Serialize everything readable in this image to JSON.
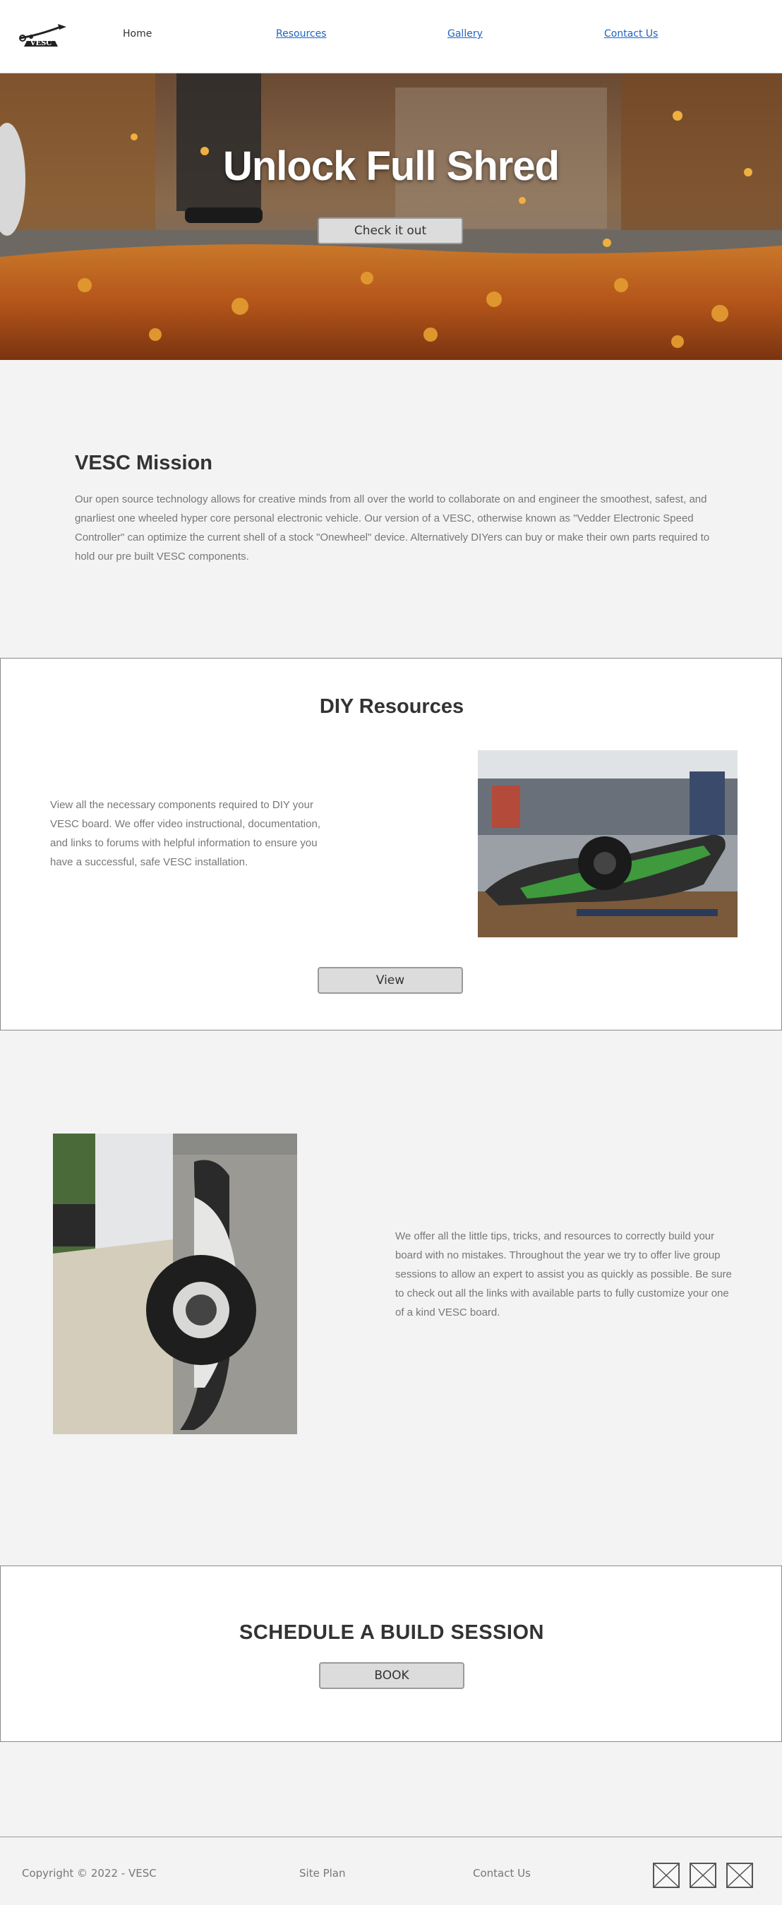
{
  "header": {
    "logo_text": "VESC",
    "nav": {
      "home": "Home",
      "resources": "Resources",
      "gallery": "Gallery",
      "contact": "Contact Us"
    }
  },
  "hero": {
    "title": "Unlock Full Shred",
    "button": "Check it out"
  },
  "mission": {
    "title": "VESC Mission",
    "text": "Our open source technology allows for creative minds from all over the world to collaborate on and engineer the smoothest, safest, and gnarliest one wheeled hyper core personal electronic vehicle. Our version of a VESC, otherwise known as \"Vedder Electronic Speed Controller\" can optimize the current shell of a stock \"Onewheel\" device. Alternatively DIYers can buy or make their own parts required to hold our pre built VESC components."
  },
  "diy": {
    "title": "DIY Resources",
    "text": "View all the necessary components required to DIY your VESC board.  We offer video instructional, documentation, and links to forums with helpful information to ensure you have a successful, safe VESC installation.",
    "button": "View"
  },
  "tips": {
    "text": "We offer all the little tips, tricks, and resources to correctly build your board with no mistakes. Throughout the year we try to offer live group sessions to allow an expert to assist you as quickly as possible. Be sure to check out all the links with available parts to fully customize your one of a kind VESC board."
  },
  "schedule": {
    "title": "SCHEDULE A BUILD SESSION",
    "button": "BOOK"
  },
  "footer": {
    "copyright": "Copyright © 2022 - VESC",
    "site_plan": "Site Plan",
    "contact": "Contact Us",
    "social_icons": [
      "placeholder-icon",
      "placeholder-icon",
      "placeholder-icon"
    ]
  },
  "colors": {
    "link": "#1e63c4",
    "background": "#f3f3f3",
    "button": "#dcdcdc"
  }
}
